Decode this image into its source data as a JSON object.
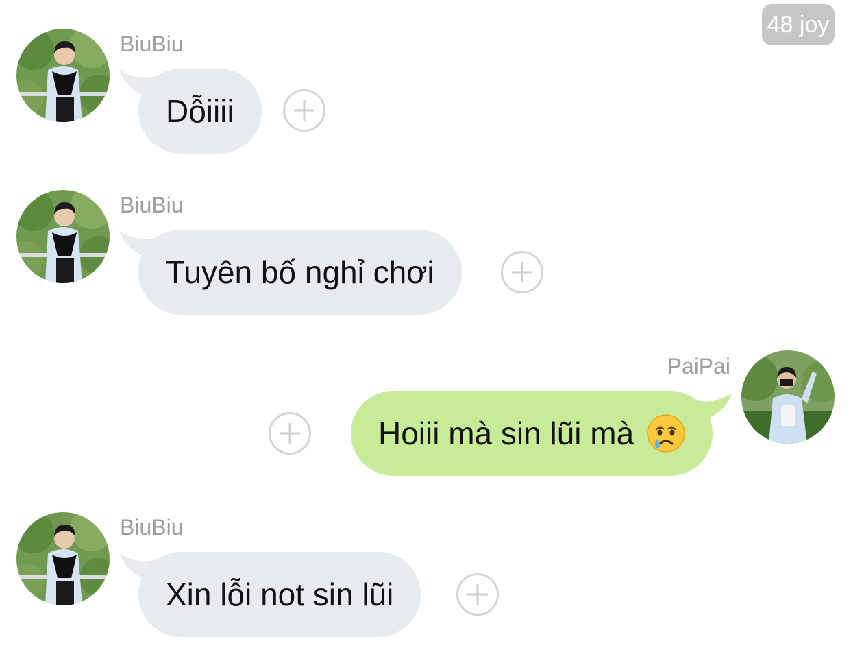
{
  "header": {
    "badge": "48 joy"
  },
  "messages": [
    {
      "direction": "incoming",
      "sender": "BiuBiu",
      "text": "Dỗiiii",
      "avatar_icon": "avatar-photo-biubiu",
      "action_icon": "add-reaction-icon"
    },
    {
      "direction": "incoming",
      "sender": "BiuBiu",
      "text": "Tuyên bố nghỉ chơi",
      "avatar_icon": "avatar-photo-biubiu",
      "action_icon": "add-reaction-icon"
    },
    {
      "direction": "outgoing",
      "sender": "PaiPai",
      "text": "Hoiii mà sin lũi mà",
      "emoji": "crying-face-emoji",
      "avatar_icon": "avatar-photo-paipai",
      "action_icon": "add-reaction-icon"
    },
    {
      "direction": "incoming",
      "sender": "BiuBiu",
      "text": "Xin lỗi not sin lũi",
      "avatar_icon": "avatar-photo-biubiu",
      "action_icon": "add-reaction-icon"
    }
  ],
  "colors": {
    "incoming_bubble": "#e7eaef",
    "outgoing_bubble": "#c8eb98",
    "sender_name": "#9d9da2",
    "badge_bg": "#c6c6c8"
  }
}
